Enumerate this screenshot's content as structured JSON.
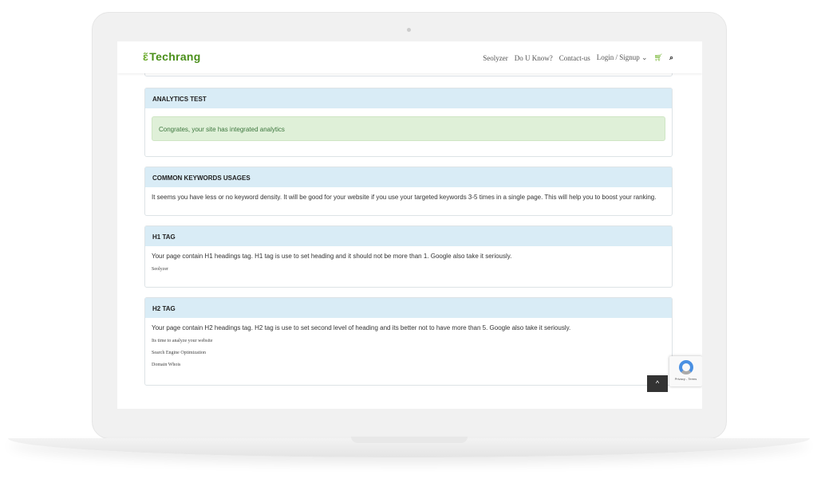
{
  "header": {
    "logo": "Techrang",
    "nav": [
      "Seolyzer",
      "Do U Know?",
      "Contact-us",
      "Login / Signup"
    ]
  },
  "panels": [
    {
      "title": "ANALYTICS TEST",
      "alert": "Congrates, your site has integrated analytics"
    },
    {
      "title": "COMMON KEYWORDS USAGES",
      "text": "It seems you have less or no keyword density. It will be good for your website if you use your targeted keywords 3-5 times in a single page. This will help you to boost your ranking."
    },
    {
      "title": "H1 TAG",
      "text": "Your page contain H1 headings tag. H1 tag is use to set heading and it should not be more than 1. Google also take it seriously.",
      "items": [
        "Seolyzer"
      ]
    },
    {
      "title": "H2 TAG",
      "text": "Your page contain H2 headings tag. H2 tag is use to set second level of heading and its better not to have more than 5. Google also take it seriously.",
      "items": [
        "Its time to analyze your website",
        "Search Engine Optimization",
        "Domain Whois"
      ]
    }
  ],
  "recaptcha": "Privacy - Terms",
  "to_top": "^"
}
